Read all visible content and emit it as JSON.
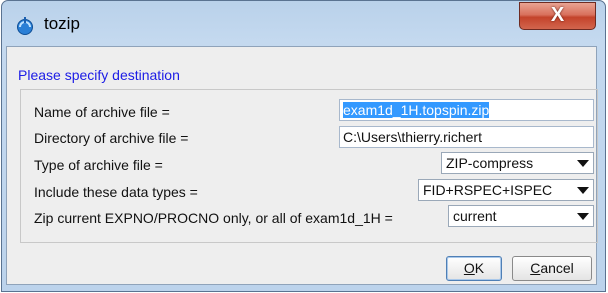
{
  "window": {
    "title": "tozip",
    "close_glyph": "X"
  },
  "dialog": {
    "header": "Please specify destination",
    "rows": [
      {
        "label": "Name of archive file =",
        "value": "exam1d_1H.topspin.zip"
      },
      {
        "label": "Directory of archive file =",
        "value": "C:\\Users\\thierry.richert"
      },
      {
        "label": "Type of archive file =",
        "value": "ZIP-compress"
      },
      {
        "label": "Include these data types =",
        "value": "FID+RSPEC+ISPEC"
      },
      {
        "label": "Zip current EXPNO/PROCNO only, or all of exam1d_1H =",
        "value": "current"
      }
    ]
  },
  "buttons": {
    "ok": {
      "mnemonic": "O",
      "rest": "K"
    },
    "cancel": {
      "mnemonic": "C",
      "rest": "ancel"
    }
  },
  "colors": {
    "header_text": "#1c1ce6",
    "selection": "#3399ff",
    "close_button": "#c4432b"
  },
  "icons": {
    "app": "topspin-icon",
    "close": "close-icon",
    "dropdown": "chevron-down-icon"
  }
}
